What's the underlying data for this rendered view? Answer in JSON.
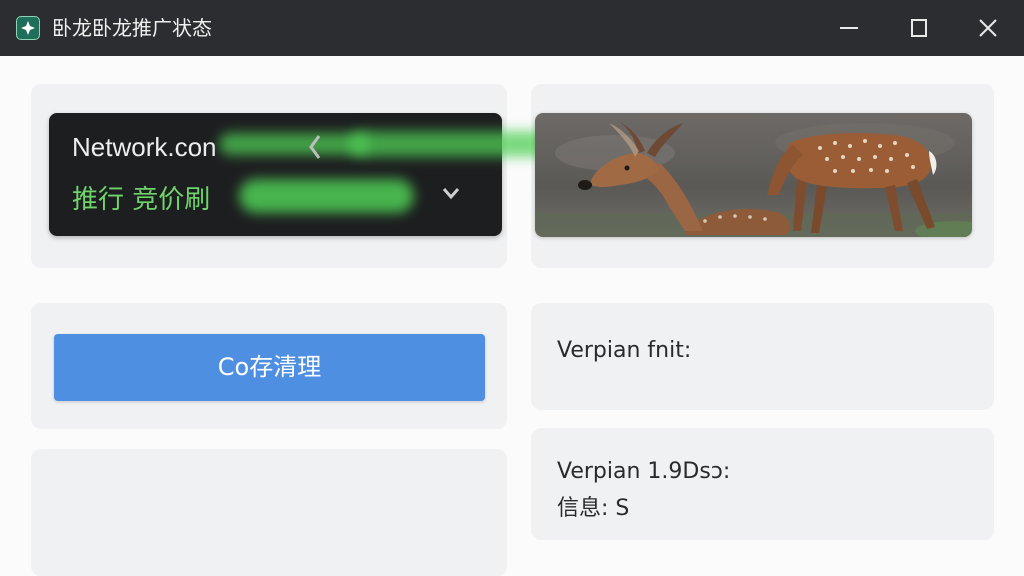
{
  "window": {
    "title": "卧龙卧龙推广状态",
    "controls": [
      "minimize-icon",
      "maximize-icon",
      "close-icon"
    ]
  },
  "network": {
    "line1": "Network.con",
    "line2": "推行 竞价刷"
  },
  "action_button": {
    "label": "Co存清理"
  },
  "version": {
    "label": "Verpian fnit:",
    "value": "Verpian 1.9Dsɔ:"
  },
  "info": {
    "label": "信息: S"
  },
  "colors": {
    "titlebar": "#2b2d31",
    "accent_button": "#4f8fe2",
    "glow_green": "#4fcf55",
    "panel_dark": "#1d1e20"
  }
}
